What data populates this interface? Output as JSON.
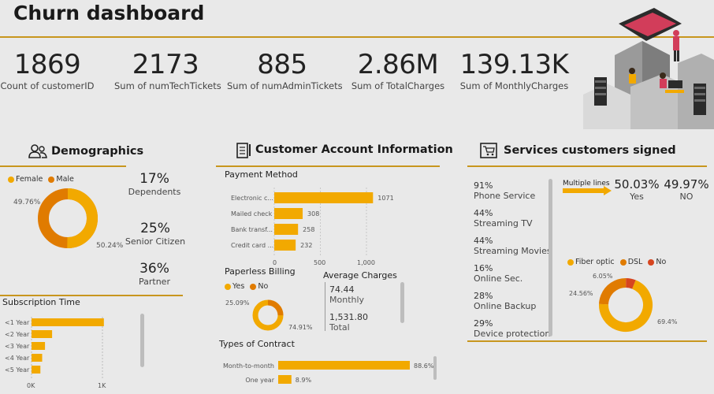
{
  "header": {
    "title": "Churn dashboard"
  },
  "kpis": [
    {
      "value": "1869",
      "label": "Count of customerID"
    },
    {
      "value": "2173",
      "label": "Sum of numTechTickets"
    },
    {
      "value": "885",
      "label": "Sum of numAdminTickets"
    },
    {
      "value": "2.86M",
      "label": "Sum of TotalCharges"
    },
    {
      "value": "139.13K",
      "label": "Sum of MonthlyCharges"
    }
  ],
  "demographics": {
    "title": "Demographics",
    "legend": [
      "Female",
      "Male"
    ],
    "donut_labels": [
      "49.76%",
      "50.24%"
    ],
    "stats": [
      {
        "value": "17%",
        "label": "Dependents"
      },
      {
        "value": "25%",
        "label": "Senior Citizen"
      },
      {
        "value": "36%",
        "label": "Partner"
      }
    ]
  },
  "subscription": {
    "title": "Subscription Time",
    "axis": [
      "0K",
      "1K"
    ]
  },
  "account": {
    "title": "Customer Account Information",
    "payment_title": "Payment Method",
    "payment_axis": [
      "0",
      "500",
      "1,000"
    ],
    "paperless_title": "Paperless Billing",
    "paperless_legend": [
      "Yes",
      "No"
    ],
    "paperless_labels": [
      "25.09%",
      "74.91%"
    ],
    "avg_title": "Average Charges",
    "avg_monthly_value": "74.44",
    "avg_monthly_label": "Monthly",
    "avg_total_value": "1,531.80",
    "avg_total_label": "Total",
    "contract_title": "Types of Contract"
  },
  "services": {
    "title": "Services customers signed",
    "items": [
      {
        "pct": "91%",
        "name": "Phone Service"
      },
      {
        "pct": "44%",
        "name": "Streaming TV"
      },
      {
        "pct": "44%",
        "name": "Streaming Movies"
      },
      {
        "pct": "16%",
        "name": "Online Sec."
      },
      {
        "pct": "28%",
        "name": "Online Backup"
      },
      {
        "pct": "29%",
        "name": "Device protection"
      }
    ],
    "multiple_lines_label": "Multiple lines",
    "multi_yes_value": "50.03%",
    "multi_yes_label": "Yes",
    "multi_no_value": "49.97%",
    "multi_no_label": "NO",
    "internet_legend": [
      "Fiber optic",
      "DSL",
      "No"
    ],
    "internet_labels": [
      "6.05%",
      "24.56%",
      "69.4%"
    ]
  },
  "colors": {
    "orange": "#f2a900",
    "dark_orange": "#e07b00",
    "red": "#d6451f",
    "rule": "#c8961e"
  },
  "chart_data": [
    {
      "type": "pie",
      "categories": [
        "Female",
        "Male"
      ],
      "values": [
        49.76,
        50.24
      ]
    },
    {
      "type": "bar",
      "categories": [
        "<1 Year",
        "<2 Year",
        "<3 Year",
        "<4 Year",
        "<5 Year"
      ],
      "values": [
        1020,
        290,
        190,
        150,
        125
      ],
      "title": "Subscription Time",
      "xlim": [
        0,
        1000
      ]
    },
    {
      "type": "bar",
      "categories": [
        "Electronic c...",
        "Mailed check",
        "Bank transf...",
        "Credit card ..."
      ],
      "values": [
        1071,
        308,
        258,
        232
      ],
      "title": "Payment Method",
      "xlim": [
        0,
        1000
      ]
    },
    {
      "type": "pie",
      "categories": [
        "Yes",
        "No"
      ],
      "values": [
        74.91,
        25.09
      ],
      "title": "Paperless Billing"
    },
    {
      "type": "bar",
      "categories": [
        "Month-to-month",
        "One year"
      ],
      "values": [
        88.6,
        8.9
      ],
      "value_labels": [
        "88.6%",
        "8.9%"
      ],
      "title": "Types of Contract"
    },
    {
      "type": "pie",
      "categories": [
        "Fiber optic",
        "DSL",
        "No"
      ],
      "values": [
        69.4,
        24.56,
        6.05
      ]
    }
  ]
}
